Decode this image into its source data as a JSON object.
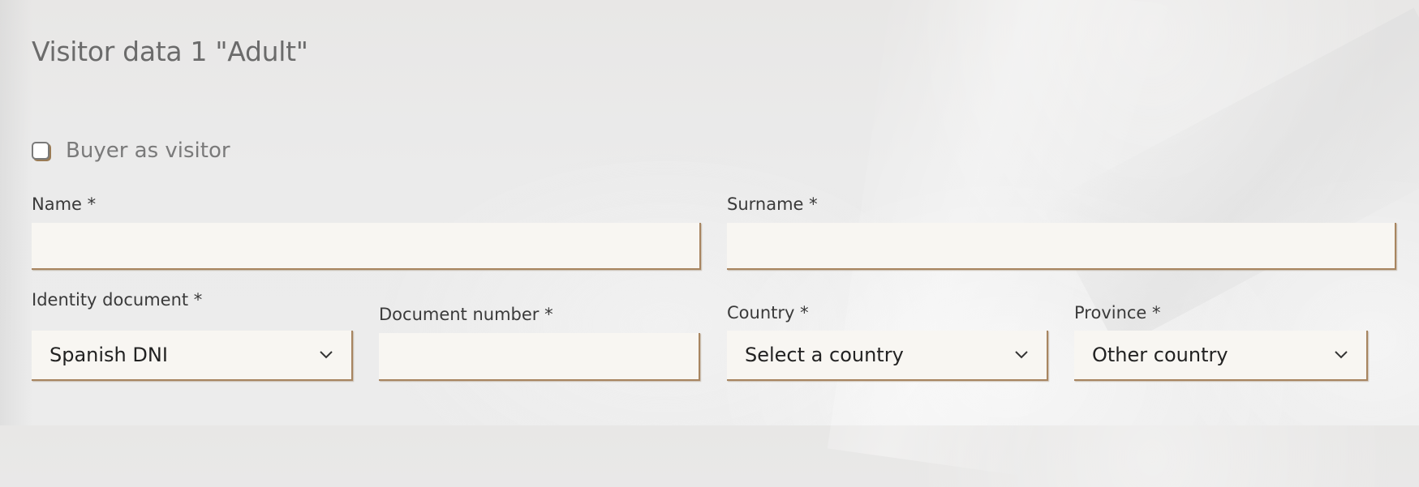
{
  "form": {
    "title": "Visitor data 1 \"Adult\"",
    "buyer_as_visitor": {
      "label": "Buyer as visitor",
      "checked": false
    },
    "name": {
      "label": "Name *",
      "value": "",
      "placeholder": ""
    },
    "surname": {
      "label": "Surname *",
      "value": "",
      "placeholder": ""
    },
    "identity_document": {
      "label": "Identity document *",
      "selected": "Spanish DNI"
    },
    "document_number": {
      "label": "Document number *",
      "value": "",
      "placeholder": ""
    },
    "country": {
      "label": "Country *",
      "selected": "Select a country"
    },
    "province": {
      "label": "Province *",
      "selected": "Other country"
    }
  },
  "icons": {
    "dropdown": "chevron-down-icon"
  },
  "colors": {
    "field_background": "#f8f6f2",
    "field_border_accent": "#a88560",
    "title_text": "#6b6b6b"
  }
}
